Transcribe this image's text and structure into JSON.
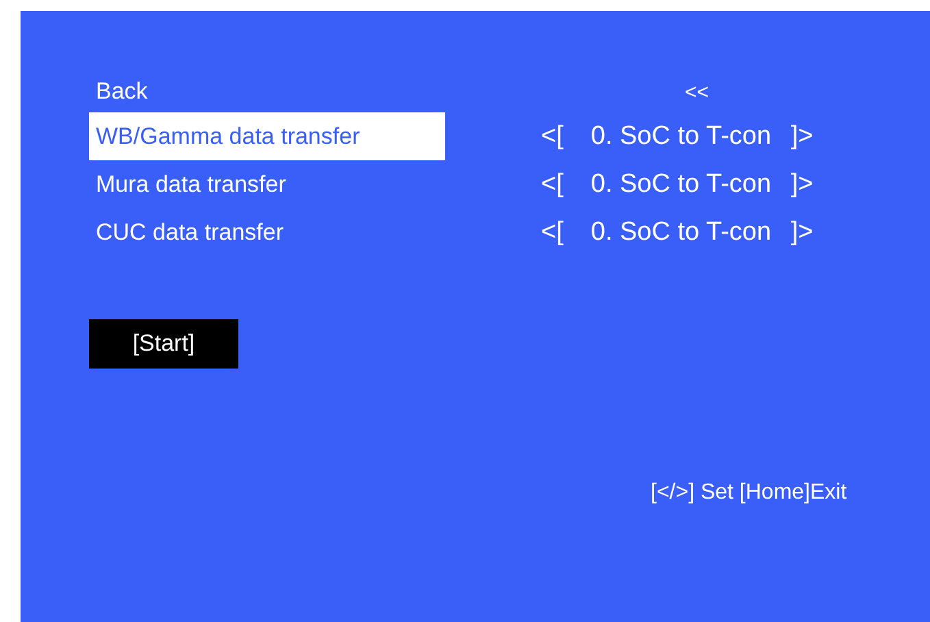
{
  "menu": {
    "back": {
      "label": "Back",
      "value": "<<",
      "selected": false
    },
    "items": [
      {
        "label": "WB/Gamma data transfer",
        "open": "<[",
        "value": "0. SoC to T-con",
        "close": "]>",
        "selected": true
      },
      {
        "label": "Mura data transfer",
        "open": "<[",
        "value": "0. SoC to T-con",
        "close": "]>",
        "selected": false
      },
      {
        "label": "CUC data transfer",
        "open": "<[",
        "value": "0. SoC to T-con",
        "close": "]>",
        "selected": false
      }
    ]
  },
  "start_button": "[Start]",
  "help_text": "[</>] Set [Home]Exit"
}
